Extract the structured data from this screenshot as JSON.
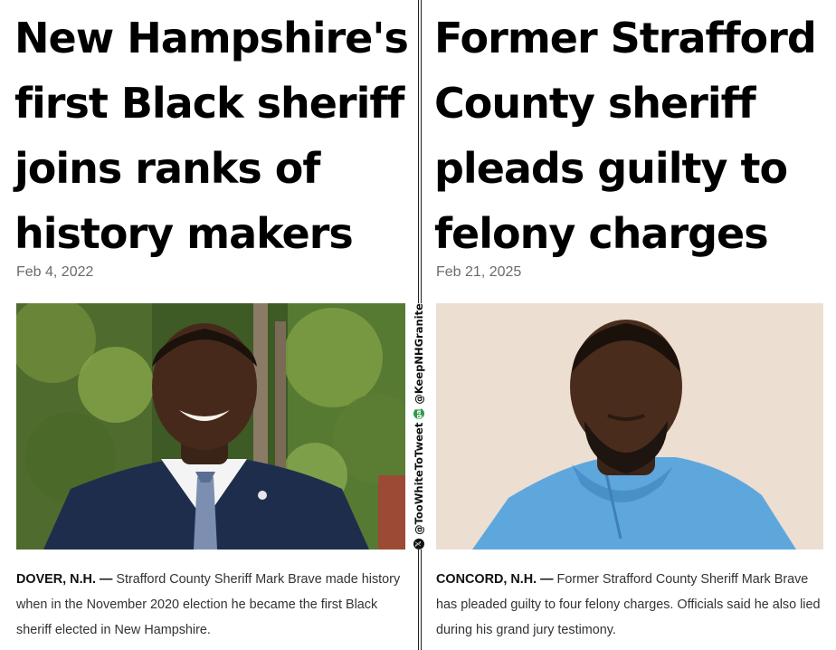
{
  "left_article": {
    "headline": "New Hampshire's\nfirst Black sheriff\njoins ranks of\nhistory makers",
    "date": "Feb 4, 2022",
    "dateline": "DOVER, N.H. —",
    "body": " Strafford County Sheriff Mark Brave made history when in the November 2020 election he became the first Black sheriff elected in New Hampshire."
  },
  "right_article": {
    "headline": "Former Strafford\nCounty sheriff\npleads guilty to\nfelony charges",
    "date": "Feb 21, 2025",
    "dateline": "CONCORD, N.H. —",
    "body": " Former Strafford County Sheriff Mark Brave has pleaded guilty to four felony charges. Officials said he also lied during his grand jury testimony."
  },
  "watermark": {
    "x_icon": "x-logo-icon",
    "x_handle": "@TooWhiteToTweet",
    "gab_icon": "gab-logo-icon",
    "gab_handle": "@KeepNHGranite",
    "x_glyph": "𝕏",
    "gab_glyph": "gab"
  },
  "colors": {
    "headline": "#000000",
    "date": "#6b6b6b",
    "caption": "#333333",
    "left_bg_foliage": "#3e5a25",
    "right_bg_wall": "#e9d8cc",
    "hoodie": "#5ea7dd",
    "suit": "#1f2d4d"
  }
}
